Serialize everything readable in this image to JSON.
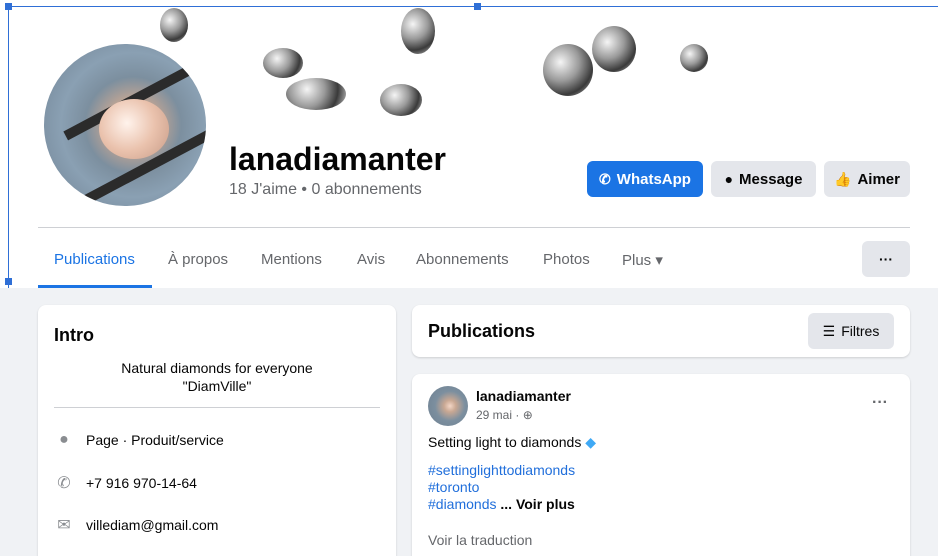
{
  "page": {
    "name": "lanadiamanter",
    "stats": "18 J'aime • 0 abonnements"
  },
  "actions": {
    "whatsapp_label": "WhatsApp",
    "message_label": "Message",
    "like_label": "Aimer"
  },
  "tabs": [
    {
      "label": "Publications",
      "active": true
    },
    {
      "label": "À propos"
    },
    {
      "label": "Mentions"
    },
    {
      "label": "Avis"
    },
    {
      "label": "Abonnements"
    },
    {
      "label": "Photos"
    },
    {
      "label": "Plus ▾"
    }
  ],
  "more_button": "···",
  "intro": {
    "title": "Intro",
    "bio_line1": "Natural diamonds for everyone",
    "bio_line2": "\"DiamVille\"",
    "rows": [
      {
        "icon": "info-icon",
        "text_bold": "Page",
        "text": " · Produit/service"
      },
      {
        "icon": "phone-icon",
        "text": "+7 916 970-14-64"
      },
      {
        "icon": "mail-icon",
        "text": "villediam@gmail.com"
      }
    ]
  },
  "publications": {
    "title": "Publications",
    "filters_label": "Filtres"
  },
  "post": {
    "author": "lanadiamanter",
    "time": "29 mai · ",
    "text": "Setting light to diamonds",
    "tags": [
      "#settinglighttodiamonds",
      "#toronto",
      "#diamonds"
    ],
    "see_more": "... Voir plus",
    "translate": "Voir la traduction",
    "menu": "···"
  },
  "colors": {
    "accent": "#1b74e4",
    "background": "#f0f2f5",
    "button_gray": "#e4e6eb",
    "link": "#216fdb"
  }
}
